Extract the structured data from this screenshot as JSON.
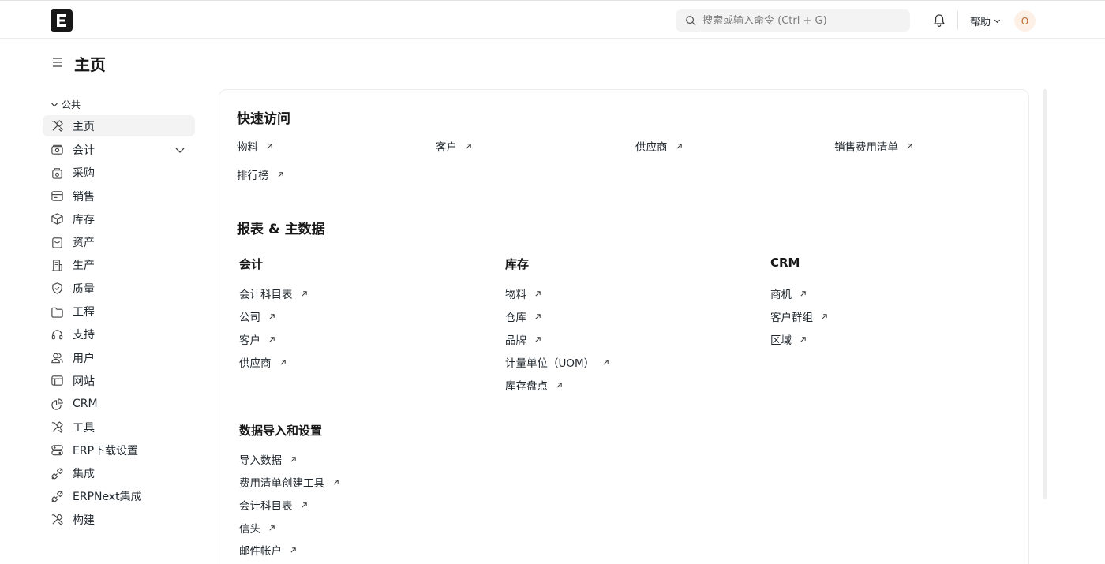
{
  "navbar": {
    "search_placeholder": "搜索或输入命令 (Ctrl + G)",
    "help_label": "帮助",
    "avatar_initial": "O"
  },
  "page": {
    "title": "主页"
  },
  "sidebar": {
    "section_label": "公共",
    "items": [
      {
        "label": "主页",
        "icon": "tools-icon"
      },
      {
        "label": "会计",
        "icon": "accounting-icon"
      },
      {
        "label": "采购",
        "icon": "buying-icon"
      },
      {
        "label": "销售",
        "icon": "selling-icon"
      },
      {
        "label": "库存",
        "icon": "stock-icon"
      },
      {
        "label": "资产",
        "icon": "assets-icon"
      },
      {
        "label": "生产",
        "icon": "manufacturing-icon"
      },
      {
        "label": "质量",
        "icon": "quality-icon"
      },
      {
        "label": "工程",
        "icon": "projects-icon"
      },
      {
        "label": "支持",
        "icon": "support-icon"
      },
      {
        "label": "用户",
        "icon": "users-icon"
      },
      {
        "label": "网站",
        "icon": "website-icon"
      },
      {
        "label": "CRM",
        "icon": "crm-icon"
      },
      {
        "label": "工具",
        "icon": "tools-icon"
      },
      {
        "label": "ERP下载设置",
        "icon": "settings-icon"
      },
      {
        "label": "集成",
        "icon": "integrations-icon"
      },
      {
        "label": "ERPNext集成",
        "icon": "integrations-icon"
      },
      {
        "label": "构建",
        "icon": "build-icon"
      }
    ]
  },
  "quick_access": {
    "title": "快速访问",
    "links": [
      "物料",
      "客户",
      "供应商",
      "销售费用清单",
      "排行榜"
    ]
  },
  "reports": {
    "title": "报表 & 主数据",
    "groups": [
      {
        "title": "会计",
        "links": [
          "会计科目表",
          "公司",
          "客户",
          "供应商"
        ]
      },
      {
        "title": "库存",
        "links": [
          "物料",
          "仓库",
          "品牌",
          "计量单位（UOM）",
          "库存盘点"
        ]
      },
      {
        "title": "CRM",
        "links": [
          "商机",
          "客户群组",
          "区域"
        ]
      },
      {
        "title": "数据导入和设置",
        "links": [
          "导入数据",
          "费用清单创建工具",
          "会计科目表",
          "信头",
          "邮件帐户"
        ]
      }
    ]
  }
}
